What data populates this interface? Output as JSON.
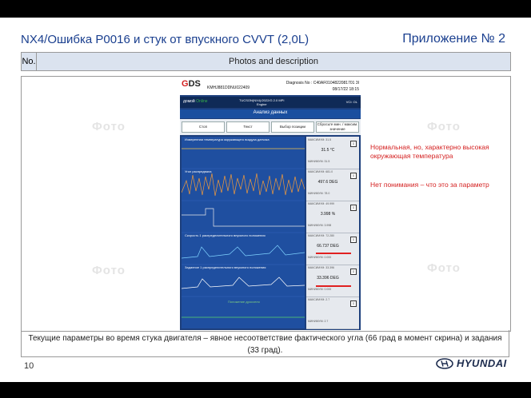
{
  "slide": {
    "title": "NX4/Ошибка P0016 и стук от впускного CVVT (2,0L)",
    "appendix": "Приложение № 2",
    "table_header": {
      "no": "No.",
      "photos": "Photos and description"
    },
    "photo_placeholders": [
      "Фото",
      "Фото",
      "Фото",
      "Фото"
    ],
    "notes": {
      "note1": "Нормальная, но, характерно высокая окружающая температура",
      "note2": "Нет понимания – что это за параметр"
    },
    "caption": "Текущие параметры во время стука двигателя – явное несоответствие фактического угла (66 град в момент скрина) и задания (33 град).",
    "page_number": "10",
    "brand": "HYUNDAI",
    "colors": {
      "title": "#1a3f8f",
      "note": "#d42020",
      "header_bg": "#dbe3ef"
    }
  },
  "screenshot": {
    "logo": "GDS",
    "vin": "KMHJ881DDNU022409",
    "diagnosis_no": "Diagnosis No : C40AF0104822081701 3I",
    "diagnosis_time": "08/17/22 18:15",
    "nav_home": "домой",
    "nav_mode": "Online",
    "nav_car_line1": "TUCSON(NX4)/2022/G 2.0 MPI",
    "nav_car_line2": "Engine",
    "nav_time": "VCI: OL",
    "screen_title": "Анализ данных",
    "buttons": [
      "Стоп",
      "Текст",
      "Выбор позиции",
      "Сбросьте мин. / максим. значение"
    ],
    "rows": [
      {
        "label": "Измеренная температура окружающего воздуха датчика",
        "value": "31.5 °C",
        "max": "МАКСИМУМ: 31.5",
        "min": "МИНИМУМ: 31.5"
      },
      {
        "label": "Угол распредвала",
        "value": "497.6 DEG",
        "max": "МАКСИМУМ: 681.0",
        "min": "МИНИМУМ: 78.0"
      },
      {
        "label": "",
        "value": "3.998 %",
        "max": "МАКСИМУМ: 49.999",
        "min": "МИНИМУМ: 3.998"
      },
      {
        "label": "Скорость 1 распределительного впускного положения",
        "value": "66.737 DEG",
        "max": "МАКСИМУМ: 72.280",
        "min": "МИНИМУМ: 0.000"
      },
      {
        "label": "Заданное 1 распределительного впускного положения",
        "value": "33.396 DEG",
        "max": "МАКСИМУМ: 33.396",
        "min": "МИНИМУМ: 0.000"
      },
      {
        "label": "Положение дросселя",
        "value": "",
        "max": "МАКСИМУМ: 2.7",
        "min": "МИНИМУМ: 2.7"
      }
    ]
  }
}
